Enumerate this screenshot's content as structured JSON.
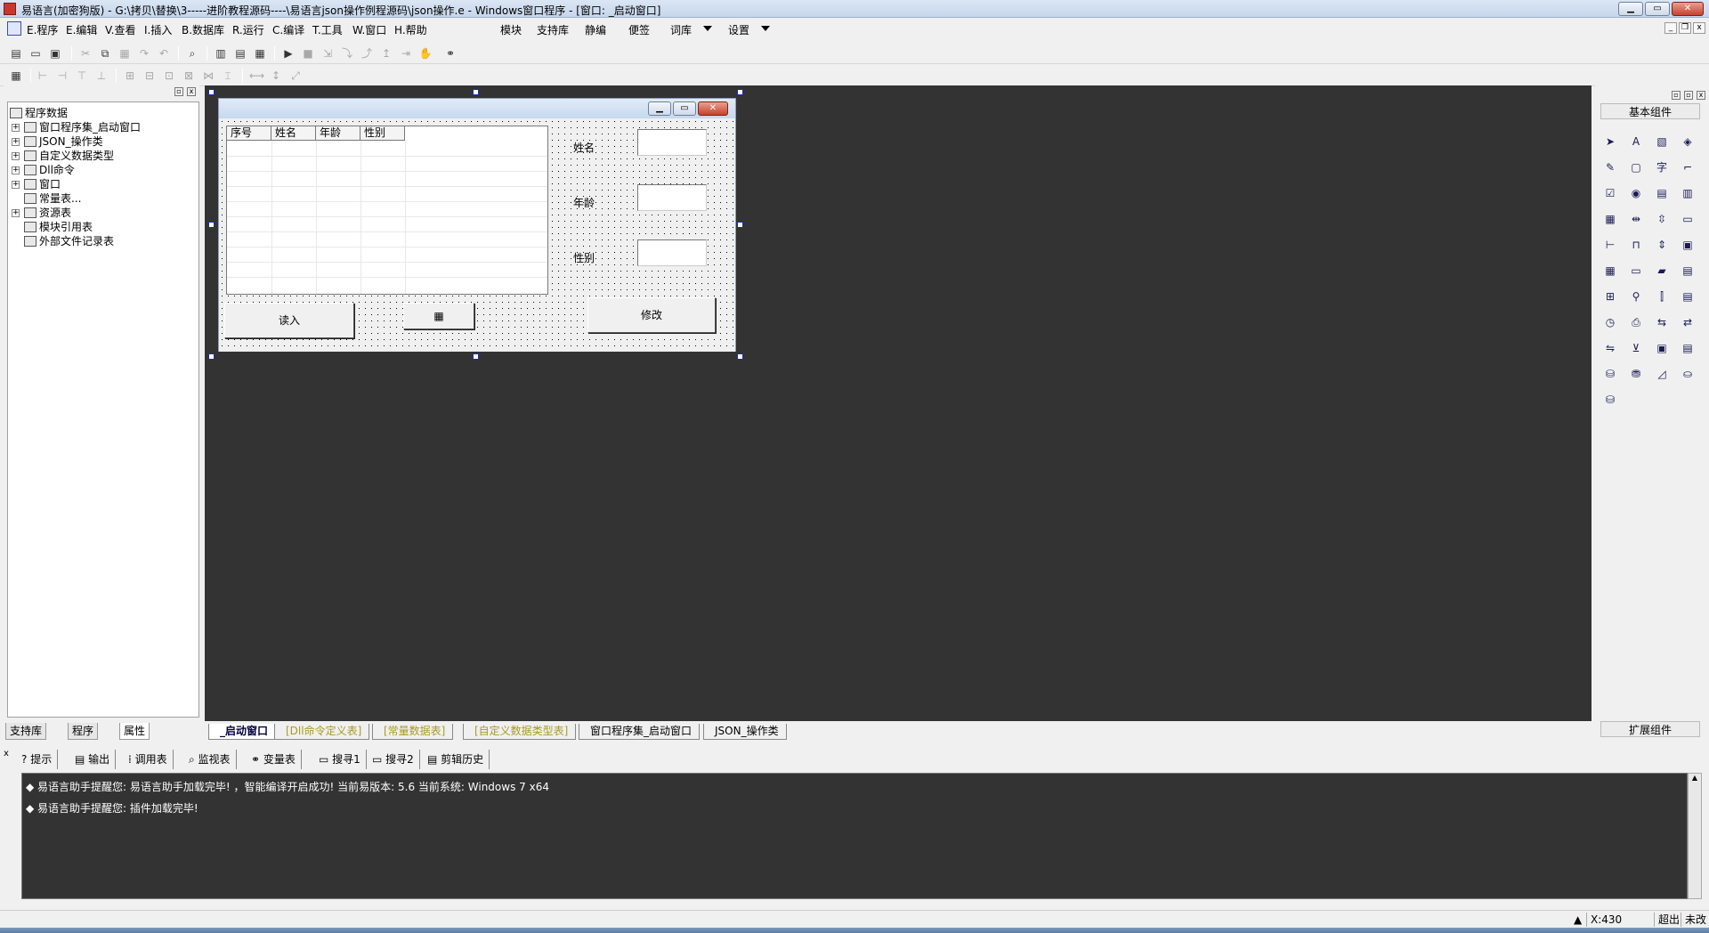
{
  "window": {
    "title": "易语言(加密狗版) - G:\\拷贝\\替换\\3-----进阶教程源码----\\易语言json操作例程源码\\json操作.e - Windows窗口程序 - [窗口: _启动窗口]",
    "min_label": "▁",
    "max_label": "▭",
    "close_label": "✕"
  },
  "menu": {
    "items": [
      "E.程序",
      "E.编辑",
      "V.查看",
      "I.插入",
      "B.数据库",
      "R.运行",
      "C.编译",
      "T.工具",
      "W.窗口",
      "H.帮助"
    ],
    "right_items": [
      "模块",
      "支持库",
      "静编",
      "便签",
      "词库",
      "设置"
    ]
  },
  "left_panel": {
    "root_label": "程序数据",
    "tree": [
      {
        "label": "窗口程序集_启动窗口",
        "expandable": true
      },
      {
        "label": "JSON_操作类",
        "expandable": true
      },
      {
        "label": "自定义数据类型",
        "expandable": true
      },
      {
        "label": "Dll命令",
        "expandable": true
      },
      {
        "label": "窗口",
        "expandable": true
      },
      {
        "label": "常量表...",
        "expandable": false
      },
      {
        "label": "资源表",
        "expandable": true
      },
      {
        "label": "模块引用表",
        "expandable": false
      },
      {
        "label": "外部文件记录表",
        "expandable": false
      }
    ],
    "tabs": [
      "支持库",
      "程序",
      "属性"
    ],
    "active_tab": "属性"
  },
  "design_window": {
    "columns": [
      "序号",
      "姓名",
      "年龄",
      "性别"
    ],
    "labels": {
      "name": "姓名",
      "age": "年龄",
      "gender": "性别"
    },
    "read_button": "读入",
    "modify_button": "修改"
  },
  "designer_tabs": [
    {
      "label": "_启动窗口",
      "style": "active"
    },
    {
      "label": "[Dll命令定义表]",
      "style": "yellow"
    },
    {
      "label": "[常量数据表]",
      "style": "yellow"
    },
    {
      "label": "[自定义数据类型表]",
      "style": "yellow"
    },
    {
      "label": "窗口程序集_启动窗口",
      "style": "normal"
    },
    {
      "label": "JSON_操作类",
      "style": "normal"
    }
  ],
  "right_panel": {
    "title": "基本组件",
    "extension": "扩展组件"
  },
  "output": {
    "tabs": [
      "提示",
      "输出",
      "调用表",
      "监视表",
      "变量表",
      "搜寻1",
      "搜寻2",
      "剪辑历史"
    ],
    "lines": [
      "易语言助手提醒您: 易语言助手加载完毕! ，智能编译开启成功! 当前易版本: 5.6  当前系统: Windows 7 x64",
      "易语言助手提醒您: 插件加载完毕!"
    ]
  },
  "status": {
    "coord": "X:430",
    "mode": "超出",
    "state": "未改"
  },
  "colors": {
    "designer_bg": "#333333",
    "selection_handle": "#1c2fa0"
  }
}
